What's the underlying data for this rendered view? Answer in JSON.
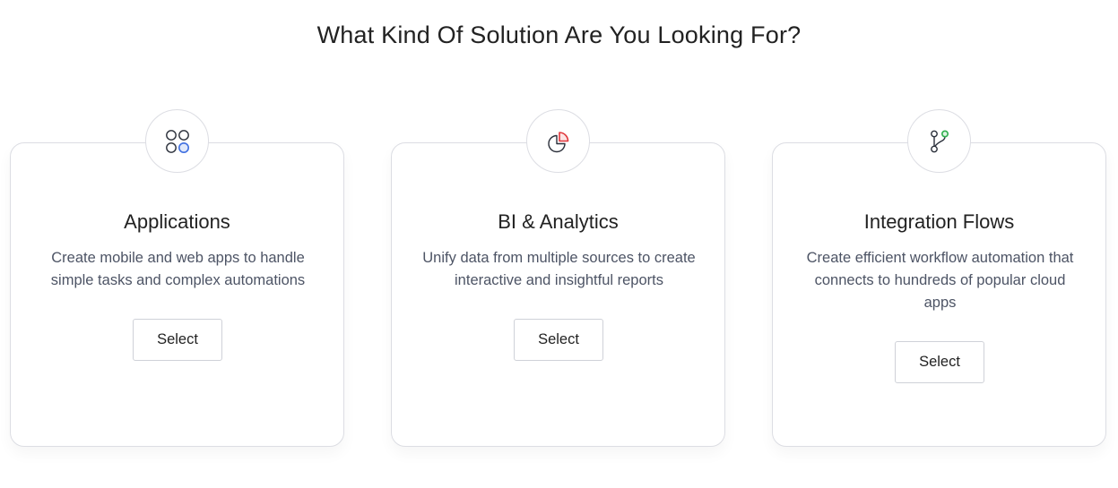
{
  "heading": "What Kind Of Solution Are You Looking For?",
  "cards": [
    {
      "icon": "apps-grid-icon",
      "title": "Applications",
      "description": "Create mobile and web apps to handle simple tasks and complex automations",
      "button": "Select",
      "icon_color": "#3f6fe0"
    },
    {
      "icon": "pie-chart-icon",
      "title": "BI & Analytics",
      "description": "Unify data from multiple sources to create interactive and insightful reports",
      "button": "Select",
      "icon_color": "#e0363b"
    },
    {
      "icon": "git-branch-icon",
      "title": "Integration Flows",
      "description": "Create efficient workflow automation that connects to hundreds of popular cloud apps",
      "button": "Select",
      "icon_color": "#2fae4d"
    }
  ]
}
